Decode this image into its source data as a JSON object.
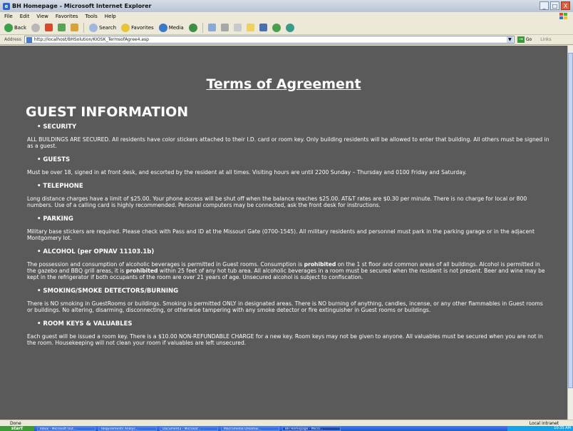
{
  "window": {
    "title": "BH Homepage - Microsoft Internet Explorer",
    "minimize": "_",
    "maximize": "□",
    "close": "X"
  },
  "menu": [
    "File",
    "Edit",
    "View",
    "Favorites",
    "Tools",
    "Help"
  ],
  "toolbar": {
    "back": "Back",
    "search": "Search",
    "favorites": "Favorites",
    "media": "Media"
  },
  "address": {
    "label": "Address",
    "url": "http://localhost/BHSolution/KIOSK_TermsofAgree4.asp",
    "go": "Go",
    "links": "Links"
  },
  "page": {
    "title": "Terms of Agreement",
    "section": "GUEST INFORMATION",
    "items": [
      {
        "head": "SECURITY",
        "body": "ALL BUILDINGS ARE SECURED. All residents have color stickers attached to their I.D. card or room key. Only building residents will be allowed to enter that building. All others must be signed in as a guest."
      },
      {
        "head": "GUESTS",
        "body": "Must be over 18, signed in at front desk, and escorted by the resident at all times. Visiting hours are until 2200 Sunday – Thursday and 0100 Friday and Saturday."
      },
      {
        "head": "TELEPHONE",
        "body": "Long distance charges have a limit of $25.00. Your phone access will be shut off when the balance reaches $25.00. AT&T rates are $0.30 per minute. There is no charge for local or 800 numbers. Use of a calling card is highly recommended. Personal computers may be connected, ask the front desk for instructions."
      },
      {
        "head": "PARKING",
        "body": "Military base stickers are required. Please check with Pass and ID at the Missouri Gate (0700-1545). All military residents and personnel must park in the parking garage or in the adjacent Montgomery lot."
      },
      {
        "head": "ALCOHOL (per OPNAV 11103.1b)",
        "body_parts": [
          "The possession and consumption of alcoholic beverages is permitted in Guest rooms. Consumption is ",
          "prohibited",
          " on the 1 st floor and common areas of all buildings. Alcohol is permitted in the gazebo and BBQ grill areas, it is ",
          "prohibited",
          " within 25 feet of any hot tub area. All alcoholic beverages in a room must be secured when the resident is not present. Beer and wine may be kept in the refrigerator if both occupants of the room are over 21 years of age. Unsecured alcohol is subject to confiscation."
        ]
      },
      {
        "head": "SMOKING/SMOKE DETECTORS/BURNING",
        "body": "There is NO smoking in GuestRooms or buildings. Smoking is permitted ONLY in designated areas. There is NO burning of anything, candles, incense, or any other flammables in Guest rooms or buildings. No altering, disarming, disconnecting, or otherwise tampering with any smoke detector or fire extinguisher in Guest rooms or buildings."
      },
      {
        "head": "ROOM KEYS & VALUABLES",
        "body": "Each guest will be issued a room key. There is a $10.00 NON-REFUNDABLE CHARGE for a new key. Room keys may not be given to anyone. All valuables must be secured when you are not in the room. Housekeeping will not clean your room if valuables are left unsecured."
      }
    ]
  },
  "status": {
    "left": "Done",
    "zone": "Local intranet"
  },
  "taskbar": {
    "start": "start",
    "tasks": [
      "Inbox - Microsoft Out...",
      "Requirements Analys...",
      "Document3 - Microsof...",
      "Macromedia Dreamw...",
      "BH Homepage - Micro..."
    ],
    "clock": "10:35 AM"
  },
  "colors": {
    "content_bg": "#5a5a5a",
    "titlebar": "#c6cfdd",
    "taskbar": "#2f66dd",
    "start": "#3c9a38"
  }
}
